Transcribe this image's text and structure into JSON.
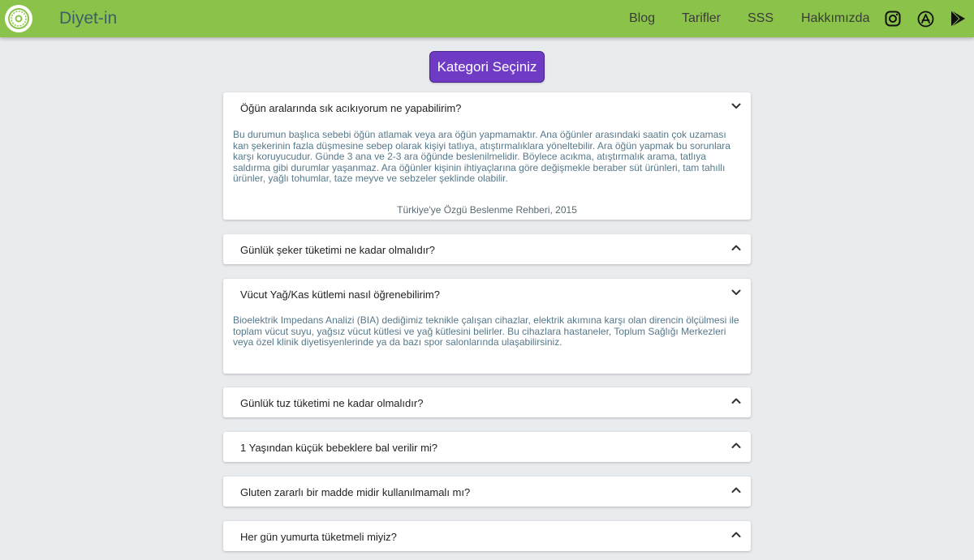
{
  "header": {
    "brand": "Diyet-in",
    "nav": [
      "Blog",
      "Tarifler",
      "SSS",
      "Hakkımızda"
    ],
    "icons": [
      "instagram-icon",
      "app-store-icon",
      "google-play-icon"
    ],
    "bg_color": "#8bc34a"
  },
  "category_button": "Kategori Seçiniz",
  "faqs": [
    {
      "question": "Öğün aralarında sık acıkıyorum ne yapabilirim?",
      "expanded": true,
      "answer": "Bu durumun başlıca sebebi öğün atlamak veya ara öğün yapmamaktır. Ana öğünler arasındaki saatin çok uzaması kan şekerinin fazla düşmesine sebep olarak kişiyi tatlıya, atıştırmalıklara yöneltebilir. Ara öğün yapmak bu sorunlara karşı koruyucudur. Günde 3 ana ve 2-3 ara öğünde beslenilmelidir. Böylece acıkma, atıştırmalık arama, tatlıya saldırma gibi durumlar yaşanmaz. Ara öğünler kişinin ihtiyaçlarına göre değişmekle beraber süt ürünleri, tam tahıllı ürünler, yağlı tohumlar, taze meyve ve sebzeler şeklinde olabilir.",
      "source": "Türkiye'ye Özgü Beslenme Rehberi, 2015"
    },
    {
      "question": "Günlük şeker tüketimi ne kadar olmalıdır?",
      "expanded": false
    },
    {
      "question": "Vücut Yağ/Kas kütlemi nasıl öğrenebilirim?",
      "expanded": true,
      "answer": "Bioelektrik Impedans Analizi (BIA) dediğimiz teknikle çalışan cihazlar, elektrik akımına karşı olan direncin ölçülmesi ile toplam vücut suyu, yağsız vücut kütlesi ve yağ kütlesini belirler. Bu cihazlara hastaneler, Toplum Sağlığı Merkezleri veya özel klinik diyetisyenlerinde ya da bazı spor salonlarında ulaşabilirsiniz."
    },
    {
      "question": "Günlük tuz tüketimi ne kadar olmalıdır?",
      "expanded": false
    },
    {
      "question": "1 Yaşından küçük bebeklere bal verilir mi?",
      "expanded": false
    },
    {
      "question": "Gluten zararlı bir madde midir kullanılmamalı mı?",
      "expanded": false
    },
    {
      "question": "Her gün yumurta tüketmeli miyiz?",
      "expanded": false
    }
  ]
}
